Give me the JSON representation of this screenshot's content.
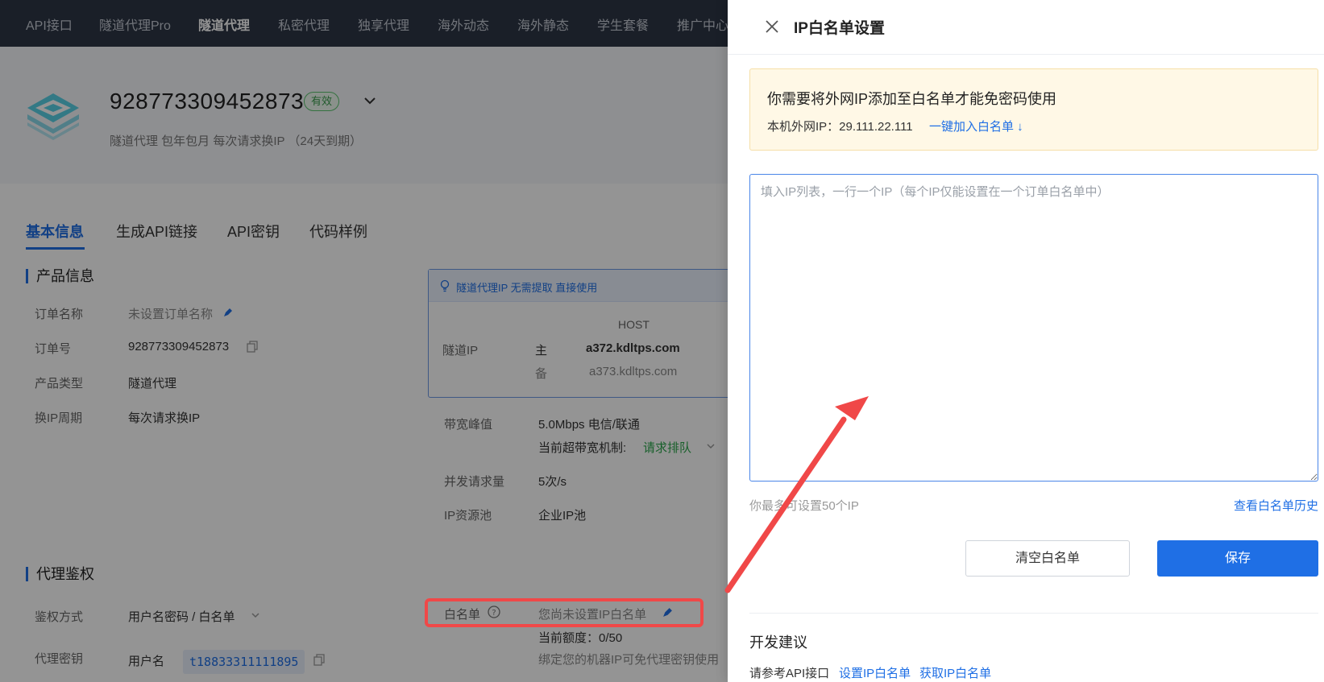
{
  "nav": {
    "items": [
      "API接口",
      "隧道代理Pro",
      "隧道代理",
      "私密代理",
      "独享代理",
      "海外动态",
      "海外静态",
      "学生套餐",
      "推广中心"
    ],
    "active": "隧道代理"
  },
  "order": {
    "id": "928773309452873",
    "status": "有效",
    "meta": "隧道代理  包年包月  每次请求换IP  （24天到期）"
  },
  "tabs": [
    "基本信息",
    "生成API链接",
    "API密钥",
    "代码样例"
  ],
  "product_info": {
    "title": "产品信息",
    "rows": [
      {
        "label": "订单名称",
        "value": "未设置订单名称"
      },
      {
        "label": "订单号",
        "value": "928773309452873"
      },
      {
        "label": "产品类型",
        "value": "隧道代理"
      },
      {
        "label": "换IP周期",
        "value": "每次请求换IP"
      }
    ]
  },
  "tunnel": {
    "hint": "隧道代理IP 无需提取 直接使用",
    "host_header": "HOST",
    "label": "隧道IP",
    "primary_tag": "主",
    "primary_host": "a372.kdltps.com",
    "backup_tag": "备",
    "backup_host": "a373.kdltps.com"
  },
  "bandwidth": {
    "label": "带宽峰值",
    "value": "5.0Mbps  电信/联通",
    "mechanism_label": "当前超带宽机制:",
    "mechanism_value": "请求排队"
  },
  "concurrency": {
    "label": "并发请求量",
    "value": "5次/s"
  },
  "pool": {
    "label": "IP资源池",
    "value": "企业IP池"
  },
  "auth": {
    "title": "代理鉴权",
    "method_label": "鉴权方式",
    "method_value": "用户名密码 / 白名单",
    "key_label": "代理密钥",
    "username_label": "用户名",
    "username_value": "t18833311111895"
  },
  "whitelist_row": {
    "label": "白名单",
    "value": "您尚未设置IP白名单",
    "quota": "当前额度：0/50",
    "bind_note": "绑定您的机器IP可免代理密钥使用"
  },
  "drawer": {
    "title": "IP白名单设置",
    "notice_title": "你需要将外网IP添加至白名单才能免密码使用",
    "local_ip_label": "本机外网IP：29.111.22.111",
    "add_link": "一键加入白名单 ↓",
    "textarea_placeholder": "填入IP列表，一行一个IP（每个IP仅能设置在一个订单白名单中）",
    "limit_note": "你最多可设置50个IP",
    "history_link": "查看白名单历史",
    "clear_button": "清空白名单",
    "save_button": "保存",
    "dev_title": "开发建议",
    "dev_prefix": "请参考API接口",
    "dev_link_set": "设置IP白名单",
    "dev_link_get": "获取IP白名单"
  },
  "colors": {
    "accent": "#1f6fe5",
    "nav_bg": "#2d3645",
    "annotation_red": "#f04848",
    "status_green": "#3a9b4d"
  }
}
